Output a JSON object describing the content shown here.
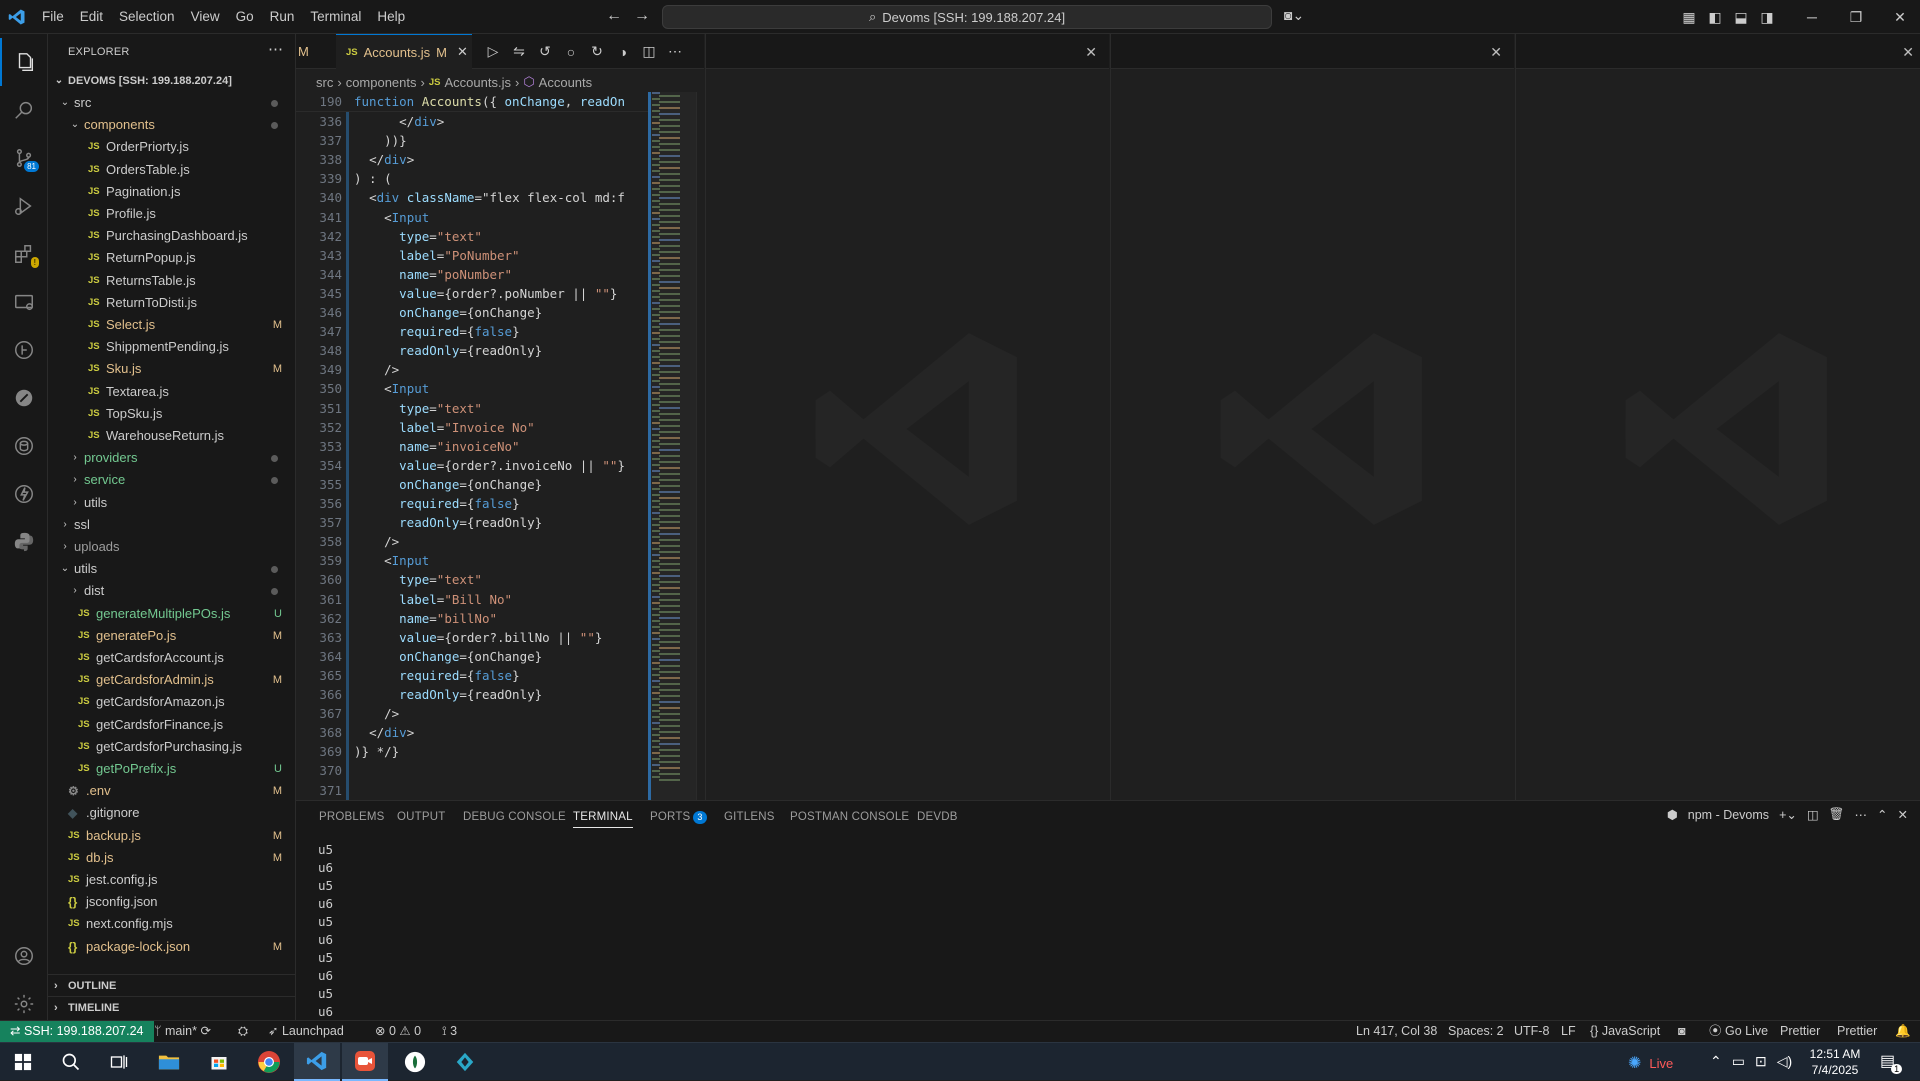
{
  "titlebar": {
    "menu": [
      "File",
      "Edit",
      "Selection",
      "View",
      "Go",
      "Run",
      "Terminal",
      "Help"
    ],
    "command_center": "Devoms [SSH: 199.188.207.24]"
  },
  "activity_bar": {
    "source_control_badge": "81"
  },
  "explorer": {
    "title": "EXPLORER",
    "root": "DEVOMS [SSH: 199.188.207.24]",
    "rows": [
      {
        "label": "src",
        "type": "folder-open",
        "indent": 0,
        "color": "c-norm",
        "status": "dot"
      },
      {
        "label": "components",
        "type": "folder-open",
        "indent": 1,
        "color": "c-mod",
        "status": "dot"
      },
      {
        "label": "OrderPriorty.js",
        "type": "js",
        "indent": 2,
        "color": "c-norm",
        "status": ""
      },
      {
        "label": "OrdersTable.js",
        "type": "js",
        "indent": 2,
        "color": "c-norm",
        "status": ""
      },
      {
        "label": "Pagination.js",
        "type": "js",
        "indent": 2,
        "color": "c-norm",
        "status": ""
      },
      {
        "label": "Profile.js",
        "type": "js",
        "indent": 2,
        "color": "c-norm",
        "status": ""
      },
      {
        "label": "PurchasingDashboard.js",
        "type": "js",
        "indent": 2,
        "color": "c-norm",
        "status": ""
      },
      {
        "label": "ReturnPopup.js",
        "type": "js",
        "indent": 2,
        "color": "c-norm",
        "status": ""
      },
      {
        "label": "ReturnsTable.js",
        "type": "js",
        "indent": 2,
        "color": "c-norm",
        "status": ""
      },
      {
        "label": "ReturnToDisti.js",
        "type": "js",
        "indent": 2,
        "color": "c-norm",
        "status": ""
      },
      {
        "label": "Select.js",
        "type": "js",
        "indent": 2,
        "color": "c-mod",
        "status": "M"
      },
      {
        "label": "ShippmentPending.js",
        "type": "js",
        "indent": 2,
        "color": "c-norm",
        "status": ""
      },
      {
        "label": "Sku.js",
        "type": "js",
        "indent": 2,
        "color": "c-mod",
        "status": "M"
      },
      {
        "label": "Textarea.js",
        "type": "js",
        "indent": 2,
        "color": "c-norm",
        "status": ""
      },
      {
        "label": "TopSku.js",
        "type": "js",
        "indent": 2,
        "color": "c-norm",
        "status": ""
      },
      {
        "label": "WarehouseReturn.js",
        "type": "js",
        "indent": 2,
        "color": "c-norm",
        "status": ""
      },
      {
        "label": "providers",
        "type": "folder",
        "indent": 1,
        "color": "c-green",
        "status": "dot"
      },
      {
        "label": "service",
        "type": "folder",
        "indent": 1,
        "color": "c-green",
        "status": "dot"
      },
      {
        "label": "utils",
        "type": "folder",
        "indent": 1,
        "color": "c-norm",
        "status": ""
      },
      {
        "label": "ssl",
        "type": "folder",
        "indent": 0,
        "color": "c-norm",
        "status": ""
      },
      {
        "label": "uploads",
        "type": "folder",
        "indent": 0,
        "color": "c-dim",
        "status": ""
      },
      {
        "label": "utils",
        "type": "folder-open",
        "indent": 0,
        "color": "c-norm",
        "status": "dot"
      },
      {
        "label": "dist",
        "type": "folder",
        "indent": 1,
        "color": "c-norm",
        "status": "dot"
      },
      {
        "label": "generateMultiplePOs.js",
        "type": "js",
        "indent": 1,
        "color": "c-unt",
        "status": "U"
      },
      {
        "label": "generatePo.js",
        "type": "js",
        "indent": 1,
        "color": "c-mod",
        "status": "M"
      },
      {
        "label": "getCardsforAccount.js",
        "type": "js",
        "indent": 1,
        "color": "c-norm",
        "status": ""
      },
      {
        "label": "getCardsforAdmin.js",
        "type": "js",
        "indent": 1,
        "color": "c-mod",
        "status": "M"
      },
      {
        "label": "getCardsforAmazon.js",
        "type": "js",
        "indent": 1,
        "color": "c-norm",
        "status": ""
      },
      {
        "label": "getCardsforFinance.js",
        "type": "js",
        "indent": 1,
        "color": "c-norm",
        "status": ""
      },
      {
        "label": "getCardsforPurchasing.js",
        "type": "js",
        "indent": 1,
        "color": "c-norm",
        "status": ""
      },
      {
        "label": "getPoPrefix.js",
        "type": "js",
        "indent": 1,
        "color": "c-unt",
        "status": "U"
      },
      {
        "label": ".env",
        "type": "gear",
        "indent": 0,
        "color": "c-mod",
        "status": "M"
      },
      {
        "label": ".gitignore",
        "type": "git",
        "indent": 0,
        "color": "c-norm",
        "status": ""
      },
      {
        "label": "backup.js",
        "type": "js",
        "indent": 0,
        "color": "c-mod",
        "status": "M"
      },
      {
        "label": "db.js",
        "type": "js",
        "indent": 0,
        "color": "c-mod",
        "status": "M"
      },
      {
        "label": "jest.config.js",
        "type": "js",
        "indent": 0,
        "color": "c-norm",
        "status": ""
      },
      {
        "label": "jsconfig.json",
        "type": "json",
        "indent": 0,
        "color": "c-norm",
        "status": ""
      },
      {
        "label": "next.config.mjs",
        "type": "js",
        "indent": 0,
        "color": "c-norm",
        "status": ""
      },
      {
        "label": "package-lock.json",
        "type": "json",
        "indent": 0,
        "color": "c-mod",
        "status": "M"
      }
    ],
    "outline": "OUTLINE",
    "timeline": "TIMELINE"
  },
  "editor": {
    "prev_tab_status": "M",
    "tab_label": "Accounts.js",
    "tab_status": "M",
    "breadcrumb": [
      "src",
      "components",
      "Accounts.js",
      "Accounts"
    ],
    "sticky": {
      "line": "190",
      "text": "function Accounts({ onChange, readOn"
    },
    "lines": [
      {
        "n": "336",
        "t": "      </div>"
      },
      {
        "n": "337",
        "t": "    ))}"
      },
      {
        "n": "338",
        "t": "  </div>"
      },
      {
        "n": "339",
        "t": ") : ("
      },
      {
        "n": "340",
        "t": "  <div className=\"flex flex-col md:f"
      },
      {
        "n": "341",
        "t": "    <Input"
      },
      {
        "n": "342",
        "t": "      type=\"text\""
      },
      {
        "n": "343",
        "t": "      label=\"PoNumber\""
      },
      {
        "n": "344",
        "t": "      name=\"poNumber\""
      },
      {
        "n": "345",
        "t": "      value={order?.poNumber || \"\"}"
      },
      {
        "n": "346",
        "t": "      onChange={onChange}"
      },
      {
        "n": "347",
        "t": "      required={false}"
      },
      {
        "n": "348",
        "t": "      readOnly={readOnly}"
      },
      {
        "n": "349",
        "t": "    />"
      },
      {
        "n": "350",
        "t": "    <Input"
      },
      {
        "n": "351",
        "t": "      type=\"text\""
      },
      {
        "n": "352",
        "t": "      label=\"Invoice No\""
      },
      {
        "n": "353",
        "t": "      name=\"invoiceNo\""
      },
      {
        "n": "354",
        "t": "      value={order?.invoiceNo || \"\"}"
      },
      {
        "n": "355",
        "t": "      onChange={onChange}"
      },
      {
        "n": "356",
        "t": "      required={false}"
      },
      {
        "n": "357",
        "t": "      readOnly={readOnly}"
      },
      {
        "n": "358",
        "t": "    />"
      },
      {
        "n": "359",
        "t": "    <Input"
      },
      {
        "n": "360",
        "t": "      type=\"text\""
      },
      {
        "n": "361",
        "t": "      label=\"Bill No\""
      },
      {
        "n": "362",
        "t": "      name=\"billNo\""
      },
      {
        "n": "363",
        "t": "      value={order?.billNo || \"\"}"
      },
      {
        "n": "364",
        "t": "      onChange={onChange}"
      },
      {
        "n": "365",
        "t": "      required={false}"
      },
      {
        "n": "366",
        "t": "      readOnly={readOnly}"
      },
      {
        "n": "367",
        "t": "    />"
      },
      {
        "n": "368",
        "t": "  </div>"
      },
      {
        "n": "369",
        "t": ")} */}"
      },
      {
        "n": "370",
        "t": ""
      },
      {
        "n": "371",
        "t": ""
      }
    ]
  },
  "panel": {
    "tabs": [
      "PROBLEMS",
      "OUTPUT",
      "DEBUG CONSOLE",
      "TERMINAL",
      "PORTS",
      "GITLENS",
      "POSTMAN CONSOLE",
      "DEVDB"
    ],
    "active_tab": "TERMINAL",
    "ports_badge": "3",
    "terminal_name": "npm - Devoms",
    "terminal_lines": [
      "u5",
      "u6",
      "u5",
      "u6",
      "u5",
      "u6",
      "u5",
      "u6",
      "u5",
      "u6"
    ]
  },
  "statusbar": {
    "remote": "SSH: 199.188.207.24",
    "branch": "main*",
    "launchpad": "Launchpad",
    "errors": "0",
    "warnings": "0",
    "ports": "3",
    "cursor": "Ln 417, Col 38",
    "spaces": "Spaces: 2",
    "encoding": "UTF-8",
    "eol": "LF",
    "language": "JavaScript",
    "golive": "Go Live",
    "prettier1": "Prettier",
    "prettier2": "Prettier"
  },
  "taskbar": {
    "live": "Live",
    "time": "12:51 AM",
    "date": "7/4/2025",
    "notif_badge": "1"
  },
  "colors": {
    "accent": "#0078d4",
    "remote": "#16825d",
    "modified": "#e2c08d",
    "untracked": "#73c991"
  }
}
